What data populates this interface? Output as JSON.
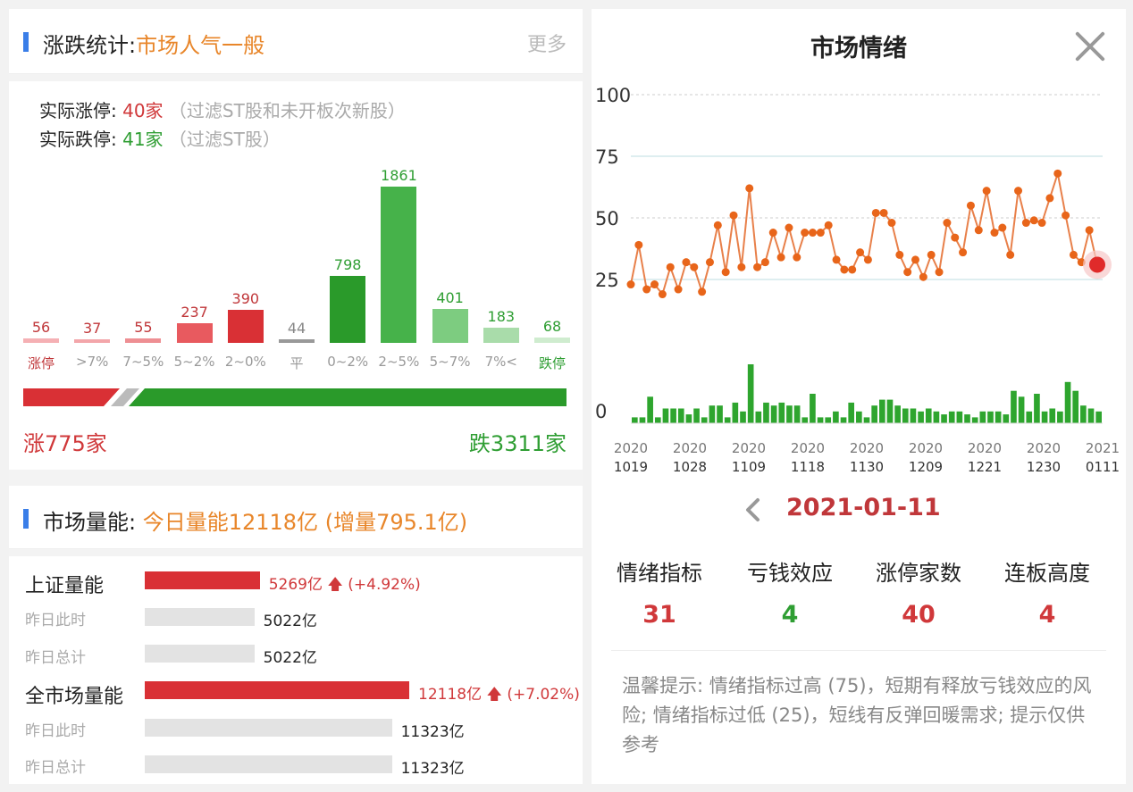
{
  "left": {
    "zhangdie": {
      "title_prefix": "涨跌统计:",
      "title_highlight": "市场人气一般",
      "more_label": "更多",
      "limit_up_label": "实际涨停:",
      "limit_up_value": "40家",
      "limit_up_note": "（过滤ST股和未开板次新股）",
      "limit_down_label": "实际跌停:",
      "limit_down_value": "41家",
      "limit_down_note": "（过滤ST股）",
      "buckets": [
        {
          "label": "涨停",
          "value": "56",
          "num": 56,
          "color": "#f5b0b4"
        },
        {
          "label": ">7%",
          "value": "37",
          "num": 37,
          "color": "#f3a6aa"
        },
        {
          "label": "7~5%",
          "value": "55",
          "num": 55,
          "color": "#ee8f93"
        },
        {
          "label": "5~2%",
          "value": "237",
          "num": 237,
          "color": "#e85a5f"
        },
        {
          "label": "2~0%",
          "value": "390",
          "num": 390,
          "color": "#d93035"
        },
        {
          "label": "平",
          "value": "44",
          "num": 44,
          "color": "#999999"
        },
        {
          "label": "0~2%",
          "value": "798",
          "num": 798,
          "color": "#2a9a2a"
        },
        {
          "label": "2~5%",
          "value": "1861",
          "num": 1861,
          "color": "#46b24a"
        },
        {
          "label": "5~7%",
          "value": "401",
          "num": 401,
          "color": "#7dcc80"
        },
        {
          "label": "7%<",
          "value": "183",
          "num": 183,
          "color": "#a9dcaa"
        },
        {
          "label": "跌停",
          "value": "68",
          "num": 68,
          "color": "#cfeccf"
        }
      ],
      "up_total_label": "涨775家",
      "down_total_label": "跌3311家"
    },
    "volume": {
      "title_prefix": "市场量能:",
      "title_highlight": "今日量能12118亿 (增量795.1亿)",
      "sh_label": "上证量能",
      "sh_today": "5269亿",
      "sh_change": "(+4.92%)",
      "sh_today_num": 5269,
      "sh_prev_same_label": "昨日此时",
      "sh_prev_same": "5022亿",
      "sh_prev_same_num": 5022,
      "sh_prev_total_label": "昨日总计",
      "sh_prev_total": "5022亿",
      "sh_prev_total_num": 5022,
      "all_label": "全市场量能",
      "all_today": "12118亿",
      "all_change": "(+7.02%)",
      "all_today_num": 12118,
      "all_prev_same_label": "昨日此时",
      "all_prev_same": "11323亿",
      "all_prev_same_num": 11323,
      "all_prev_total_label": "昨日总计",
      "all_prev_total": "11323亿",
      "all_prev_total_num": 11323
    }
  },
  "right": {
    "title": "市场情绪",
    "date": "2021-01-11",
    "metrics": [
      {
        "name": "情绪指标",
        "value": "31",
        "color": "#d0383a"
      },
      {
        "name": "亏钱效应",
        "value": "4",
        "color": "#2f9e33"
      },
      {
        "name": "涨停家数",
        "value": "40",
        "color": "#d0383a"
      },
      {
        "name": "连板高度",
        "value": "4",
        "color": "#d0383a"
      }
    ],
    "tip": "温馨提示: 情绪指标过高 (75)，短期有释放亏钱效应的风险; 情绪指标过低 (25)，短线有反弹回暖需求; 提示仅供参考"
  },
  "chart_data": {
    "type": "line",
    "y_ticks": [
      "100",
      "75",
      "50",
      "25",
      "0"
    ],
    "ylim": [
      0,
      100
    ],
    "x_ticks": [
      {
        "top": "2020",
        "bottom": "1019"
      },
      {
        "top": "2020",
        "bottom": "1028"
      },
      {
        "top": "2020",
        "bottom": "1109"
      },
      {
        "top": "2020",
        "bottom": "1118"
      },
      {
        "top": "2020",
        "bottom": "1130"
      },
      {
        "top": "2020",
        "bottom": "1209"
      },
      {
        "top": "2020",
        "bottom": "1221"
      },
      {
        "top": "2020",
        "bottom": "1230"
      },
      {
        "top": "2021",
        "bottom": "0111"
      }
    ],
    "series": [
      {
        "values": [
          23,
          39,
          21,
          23,
          19,
          30,
          21,
          32,
          30,
          20,
          32,
          47,
          28,
          51,
          30,
          62,
          30,
          32,
          44,
          34,
          46,
          34,
          44,
          44,
          44,
          47,
          33,
          29,
          29,
          36,
          33,
          52,
          52,
          48,
          35,
          28,
          33,
          26,
          35,
          28,
          48,
          42,
          36,
          55,
          45,
          61,
          44,
          46,
          35,
          61,
          48,
          49,
          48,
          58,
          68,
          51,
          35,
          32,
          45,
          31
        ]
      },
      {
        "values": [
          2,
          2,
          9,
          2,
          5,
          5,
          5,
          3,
          5,
          2,
          6,
          6,
          2,
          7,
          4,
          20,
          4,
          7,
          6,
          7,
          6,
          6,
          2,
          10,
          2,
          2,
          4,
          2,
          7,
          4,
          2,
          6,
          8,
          8,
          6,
          5,
          5,
          4,
          5,
          4,
          3,
          4,
          4,
          3,
          2,
          4,
          4,
          4,
          3,
          11,
          9,
          4,
          10,
          4,
          5,
          4,
          14,
          11,
          6,
          5,
          4
        ]
      }
    ]
  }
}
